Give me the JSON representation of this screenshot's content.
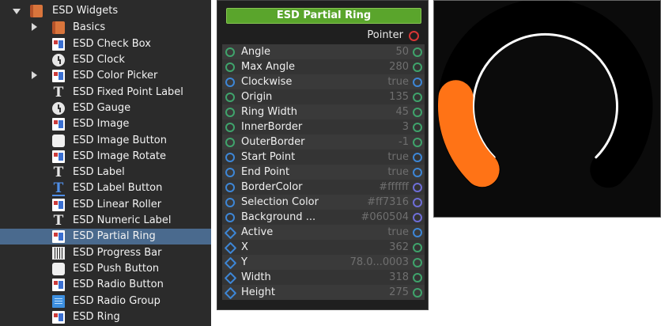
{
  "tree": {
    "root_label": "ESD Widgets",
    "items": [
      {
        "label": "Basics",
        "icon": "book-icon"
      },
      {
        "label": "ESD Check Box",
        "icon": "widget-icon"
      },
      {
        "label": "ESD Clock",
        "icon": "clock-icon"
      },
      {
        "label": "ESD Color Picker",
        "icon": "widget-icon"
      },
      {
        "label": "ESD Fixed Point Label",
        "icon": "text-icon"
      },
      {
        "label": "ESD Gauge",
        "icon": "clock-icon"
      },
      {
        "label": "ESD Image",
        "icon": "widget-icon"
      },
      {
        "label": "ESD Image Button",
        "icon": "button-icon"
      },
      {
        "label": "ESD Image Rotate",
        "icon": "widget-icon"
      },
      {
        "label": "ESD Label",
        "icon": "text-icon"
      },
      {
        "label": "ESD Label Button",
        "icon": "text-button-icon"
      },
      {
        "label": "ESD Linear Roller",
        "icon": "widget-icon"
      },
      {
        "label": "ESD Numeric Label",
        "icon": "text-icon"
      },
      {
        "label": "ESD Partial Ring",
        "icon": "widget-icon"
      },
      {
        "label": "ESD Progress Bar",
        "icon": "progress-icon"
      },
      {
        "label": "ESD Push Button",
        "icon": "button-icon"
      },
      {
        "label": "ESD Radio Button",
        "icon": "widget-icon"
      },
      {
        "label": "ESD Radio Group",
        "icon": "document-icon"
      },
      {
        "label": "ESD Ring",
        "icon": "widget-icon"
      }
    ],
    "selected": "ESD Partial Ring"
  },
  "props": {
    "title": "ESD Partial Ring",
    "pointer_label": "Pointer",
    "rows": [
      {
        "name": "Angle",
        "value": "50"
      },
      {
        "name": "Max Angle",
        "value": "280"
      },
      {
        "name": "Clockwise",
        "value": "true"
      },
      {
        "name": "Origin",
        "value": "135"
      },
      {
        "name": "Ring Width",
        "value": "45"
      },
      {
        "name": "InnerBorder",
        "value": "3"
      },
      {
        "name": "OuterBorder",
        "value": "-1"
      },
      {
        "name": "Start Point",
        "value": "true"
      },
      {
        "name": "End Point",
        "value": "true"
      },
      {
        "name": "BorderColor",
        "value": "#ffffff"
      },
      {
        "name": "Selection Color",
        "value": "#ff7316"
      },
      {
        "name": "Background ...",
        "value": "#060504"
      },
      {
        "name": "Active",
        "value": "true"
      },
      {
        "name": "X",
        "value": "362"
      },
      {
        "name": "Y",
        "value": "78.0...0003"
      },
      {
        "name": "Width",
        "value": "318"
      },
      {
        "name": "Height",
        "value": "275"
      }
    ]
  },
  "colors": {
    "title_green": "#5aa52c",
    "selection_blue": "#4a6a8e",
    "ring_selection": "#ff7316",
    "ring_background": "#060504",
    "ring_border": "#ffffff"
  }
}
